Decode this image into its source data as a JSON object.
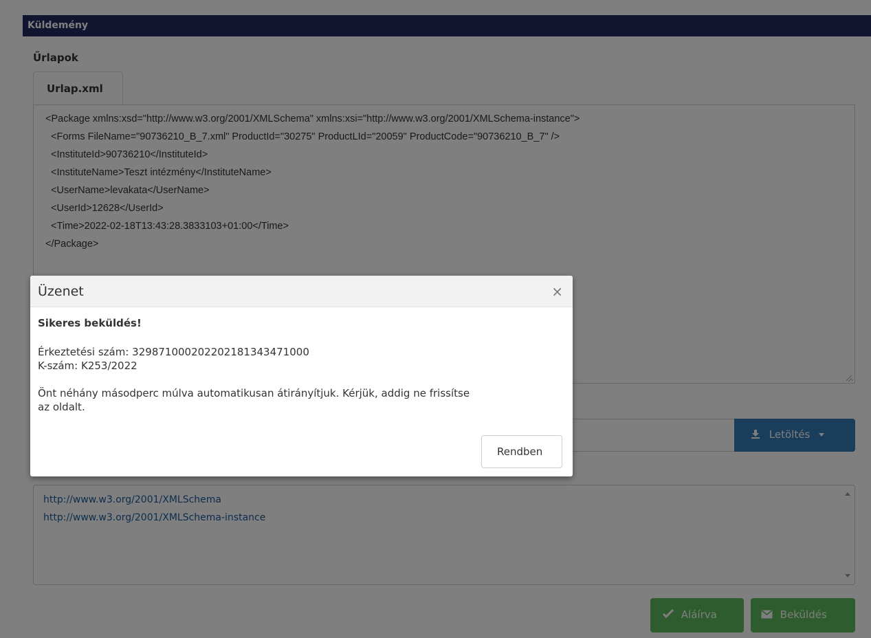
{
  "window": {
    "title": "Küldemény"
  },
  "forms": {
    "section_label": "Űrlapok",
    "tab_label": "Urlap.xml",
    "xml_lines": [
      "<Package xmlns:xsd=\"http://www.w3.org/2001/XMLSchema\" xmlns:xsi=\"http://www.w3.org/2001/XMLSchema-instance\">",
      "  <Forms FileName=\"90736210_B_7.xml\" ProductId=\"30275\" ProductLId=\"20059\" ProductCode=\"90736210_B_7\" />",
      "  <InstituteId>90736210</InstituteId>",
      "  <InstituteName>Teszt intézmény</InstituteName>",
      "  <UserName>levakata</UserName>",
      "  <UserId>12628</UserId>",
      "  <Time>2022-02-18T13:43:28.3833103+01:00</Time>",
      "</Package>"
    ]
  },
  "file_row": {
    "download_label": "Letöltés"
  },
  "namespaces": {
    "items": [
      "http://www.w3.org/2001/XMLSchema",
      "http://www.w3.org/2001/XMLSchema-instance"
    ]
  },
  "actions": {
    "signed_label": "Aláírva",
    "submit_label": "Beküldés"
  },
  "modal": {
    "title": "Üzenet",
    "close_glyph": "×",
    "headline": "Sikeres beküldés!",
    "arrival_number_line": "Érkeztetési szám: 3298710002022021813434710​00",
    "k_number_line": "K-szám: K253/2022",
    "redirect_line_1": "Önt néhány másodperc múlva automatikusan átirányítjuk. Kérjük, addig ne frissítse",
    "redirect_line_2": "az oldalt.",
    "ok_label": "Rendben"
  },
  "colors": {
    "title_bar": "#222a5f",
    "primary": "#337ab7",
    "success": "#5cb85c"
  }
}
